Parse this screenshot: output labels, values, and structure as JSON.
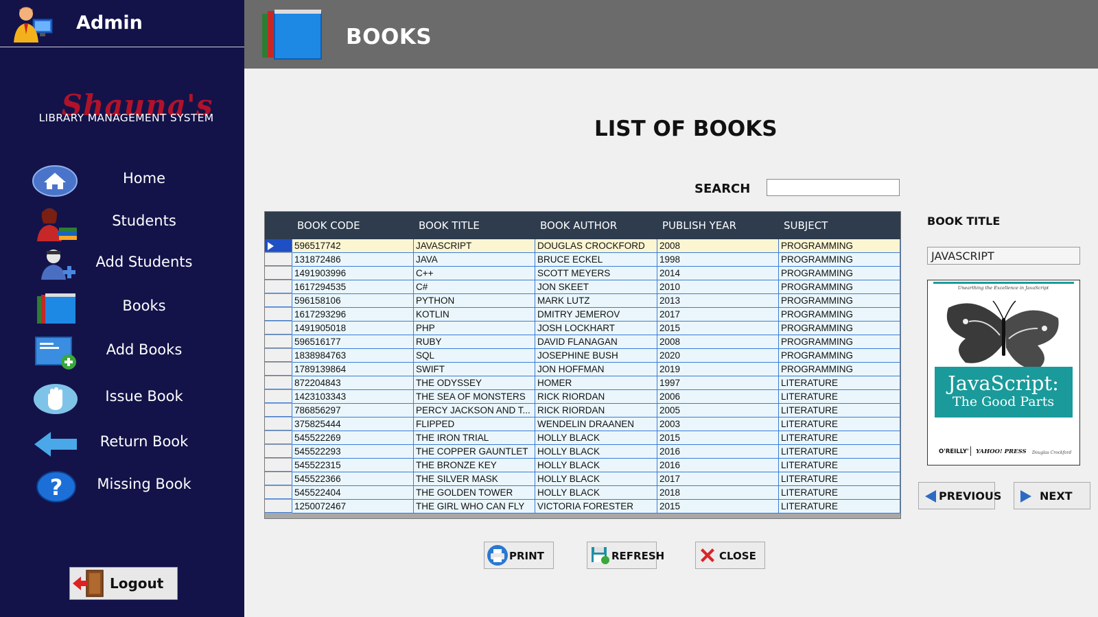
{
  "sidebar": {
    "admin_label": "Admin",
    "logo_script": "Shauna's",
    "logo_subtitle": "LIBRARY MANAGEMENT SYSTEM",
    "items": [
      {
        "label": "Home",
        "icon": "home-icon"
      },
      {
        "label": "Students",
        "icon": "students-icon"
      },
      {
        "label": "Add Students",
        "icon": "add-student-icon"
      },
      {
        "label": "Books",
        "icon": "books-icon"
      },
      {
        "label": "Add Books",
        "icon": "add-book-icon"
      },
      {
        "label": "Issue Book",
        "icon": "hand-icon"
      },
      {
        "label": "Return Book",
        "icon": "arrow-left-icon"
      },
      {
        "label": "Missing Book",
        "icon": "question-icon"
      }
    ],
    "logout_label": "Logout"
  },
  "header": {
    "title": "BOOKS"
  },
  "main": {
    "page_title": "LIST OF BOOKS",
    "search_label": "SEARCH",
    "search_value": "",
    "columns": [
      "BOOK CODE",
      "BOOK TITLE",
      "BOOK AUTHOR",
      "PUBLISH YEAR",
      "SUBJECT"
    ],
    "rows": [
      [
        "596517742",
        "JAVASCRIPT",
        "DOUGLAS CROCKFORD",
        "2008",
        "PROGRAMMING"
      ],
      [
        "131872486",
        "JAVA",
        "BRUCE ECKEL",
        "1998",
        "PROGRAMMING"
      ],
      [
        "1491903996",
        "C++",
        "SCOTT MEYERS",
        "2014",
        "PROGRAMMING"
      ],
      [
        "1617294535",
        "C#",
        "JON SKEET",
        "2010",
        "PROGRAMMING"
      ],
      [
        "596158106",
        "PYTHON",
        "MARK LUTZ",
        "2013",
        "PROGRAMMING"
      ],
      [
        "1617293296",
        "KOTLIN",
        "DMITRY JEMEROV",
        "2017",
        "PROGRAMMING"
      ],
      [
        "1491905018",
        "PHP",
        "JOSH LOCKHART",
        "2015",
        "PROGRAMMING"
      ],
      [
        "596516177",
        "RUBY",
        "DAVID FLANAGAN",
        "2008",
        "PROGRAMMING"
      ],
      [
        "1838984763",
        "SQL",
        "JOSEPHINE BUSH",
        "2020",
        "PROGRAMMING"
      ],
      [
        "1789139864",
        "SWIFT",
        "JON HOFFMAN",
        "2019",
        "PROGRAMMING"
      ],
      [
        "872204843",
        "THE ODYSSEY",
        "HOMER",
        "1997",
        "LITERATURE"
      ],
      [
        "1423103343",
        "THE SEA OF MONSTERS",
        "RICK RIORDAN",
        "2006",
        "LITERATURE"
      ],
      [
        "786856297",
        "PERCY JACKSON AND T...",
        "RICK RIORDAN",
        "2005",
        "LITERATURE"
      ],
      [
        "375825444",
        "FLIPPED",
        "WENDELIN DRAANEN",
        "2003",
        "LITERATURE"
      ],
      [
        "545522269",
        "THE IRON TRIAL",
        "HOLLY BLACK",
        "2015",
        "LITERATURE"
      ],
      [
        "545522293",
        "THE COPPER GAUNTLET",
        "HOLLY BLACK",
        "2016",
        "LITERATURE"
      ],
      [
        "545522315",
        "THE BRONZE KEY",
        "HOLLY BLACK",
        "2016",
        "LITERATURE"
      ],
      [
        "545522366",
        "THE SILVER MASK",
        "HOLLY BLACK",
        "2017",
        "LITERATURE"
      ],
      [
        "545522404",
        "THE GOLDEN TOWER",
        "HOLLY BLACK",
        "2018",
        "LITERATURE"
      ],
      [
        "1250072467",
        "THE GIRL WHO CAN FLY",
        "VICTORIA FORESTER",
        "2015",
        "LITERATURE"
      ]
    ],
    "print_label": "PRINT",
    "refresh_label": "REFRESH",
    "close_label": "CLOSE"
  },
  "detail": {
    "book_title_label": "BOOK TITLE",
    "book_title_value": "JAVASCRIPT",
    "cover_tagline": "Unearthing the Excellence in JavaScript",
    "cover_title_1": "JavaScript:",
    "cover_title_2": "The Good Parts",
    "cover_publisher": "O'REILLY'",
    "cover_press": "YAHOO! PRESS",
    "cover_author": "Douglas Crockford",
    "previous_label": "PREVIOUS",
    "next_label": "NEXT"
  },
  "colors": {
    "sidebar_bg": "#13134a",
    "header_bg": "#6b6b6b",
    "grid_header_bg": "#2e3c4e",
    "row_bg": "#eaf6fb",
    "active_row_bg": "#fbf5d2",
    "cover_teal": "#1a9a9a"
  }
}
